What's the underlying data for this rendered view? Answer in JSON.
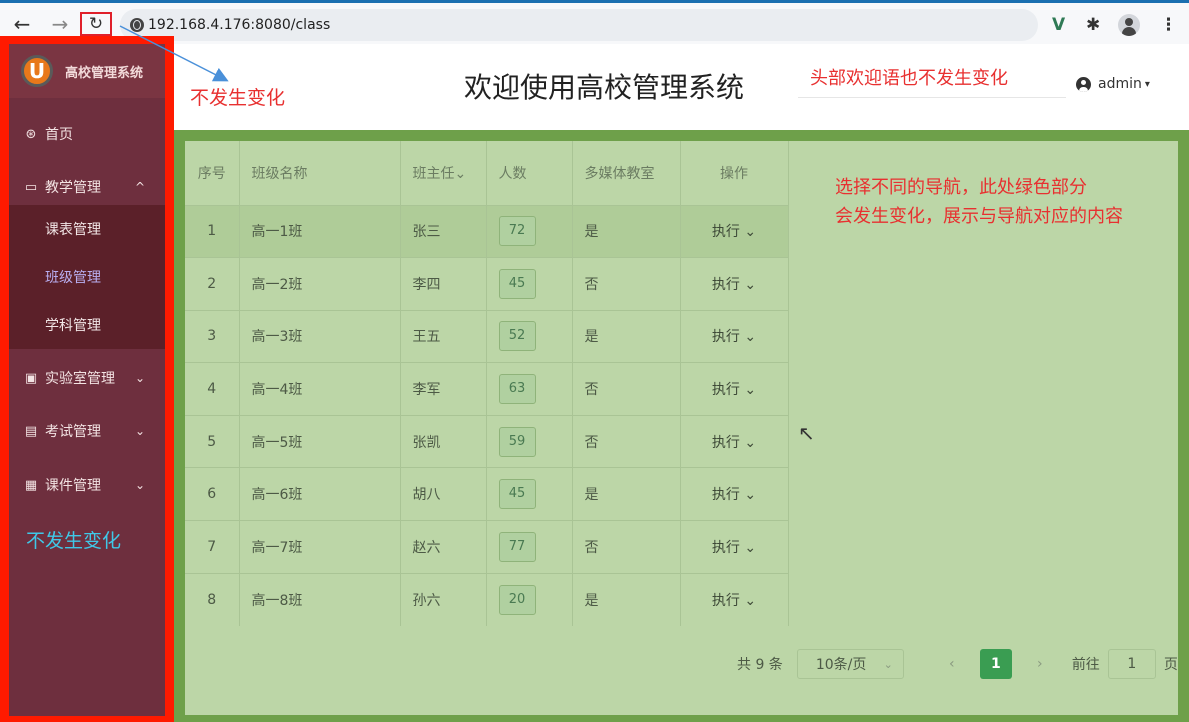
{
  "browser": {
    "url": "192.168.4.176:8080/class",
    "back_icon": "←",
    "forward_icon": "→",
    "reload_icon": "↻",
    "ext_icon": "V",
    "puzzle_icon": "✱",
    "menu_icon": "⋮"
  },
  "sidebar": {
    "logo_mark": "U",
    "logo_text": "高校管理系统",
    "items": [
      {
        "label": "首页",
        "icon": "⊛"
      },
      {
        "label": "教学管理",
        "icon": "▭",
        "chevron": "^"
      },
      {
        "label": "实验室管理",
        "icon": "▣",
        "chevron": "⌄"
      },
      {
        "label": "考试管理",
        "icon": "▤",
        "chevron": "⌄"
      },
      {
        "label": "课件管理",
        "icon": "▦",
        "chevron": "⌄"
      }
    ],
    "sub_items": [
      {
        "label": "课表管理"
      },
      {
        "label": "班级管理"
      },
      {
        "label": "学科管理"
      }
    ],
    "note": "不发生变化"
  },
  "header": {
    "title": "欢迎使用高校管理系统",
    "note": "头部欢迎语也不发生变化",
    "user": "admin",
    "caret": "▾"
  },
  "annotations": {
    "top_note": "不发生变化",
    "content_note_line1": "选择不同的导航，此处绿色部分",
    "content_note_line2": "会发生变化，展示与导航对应的内容"
  },
  "table": {
    "headers": [
      "序号",
      "班级名称",
      "班主任⌄",
      "人数",
      "多媒体教室",
      "操作"
    ],
    "action_label": "执行 ⌄",
    "rows": [
      {
        "no": "1",
        "name": "高一1班",
        "teacher": "张三",
        "count": "72",
        "media": "是"
      },
      {
        "no": "2",
        "name": "高一2班",
        "teacher": "李四",
        "count": "45",
        "media": "否"
      },
      {
        "no": "3",
        "name": "高一3班",
        "teacher": "王五",
        "count": "52",
        "media": "是"
      },
      {
        "no": "4",
        "name": "高一4班",
        "teacher": "李军",
        "count": "63",
        "media": "否"
      },
      {
        "no": "5",
        "name": "高一5班",
        "teacher": "张凯",
        "count": "59",
        "media": "否"
      },
      {
        "no": "6",
        "name": "高一6班",
        "teacher": "胡八",
        "count": "45",
        "media": "是"
      },
      {
        "no": "7",
        "name": "高一7班",
        "teacher": "赵六",
        "count": "77",
        "media": "否"
      },
      {
        "no": "8",
        "name": "高一8班",
        "teacher": "孙六",
        "count": "20",
        "media": "是"
      }
    ]
  },
  "pager": {
    "total": "共 9 条",
    "size": "10条/页",
    "size_caret": "⌄",
    "prev": "‹",
    "page": "1",
    "next": "›",
    "goto": "前往",
    "goto_value": "1",
    "goto_suffix": "页"
  },
  "colors": {
    "sidebar_border": "#ff1a00",
    "sidebar_bg": "#6e2f3e",
    "content_frame": "#6ea04a",
    "content_bg": "#bcd6a7",
    "annotation_red": "#e83030",
    "annotation_cyan": "#3fc8e8",
    "pager_active": "#3a9d52"
  }
}
